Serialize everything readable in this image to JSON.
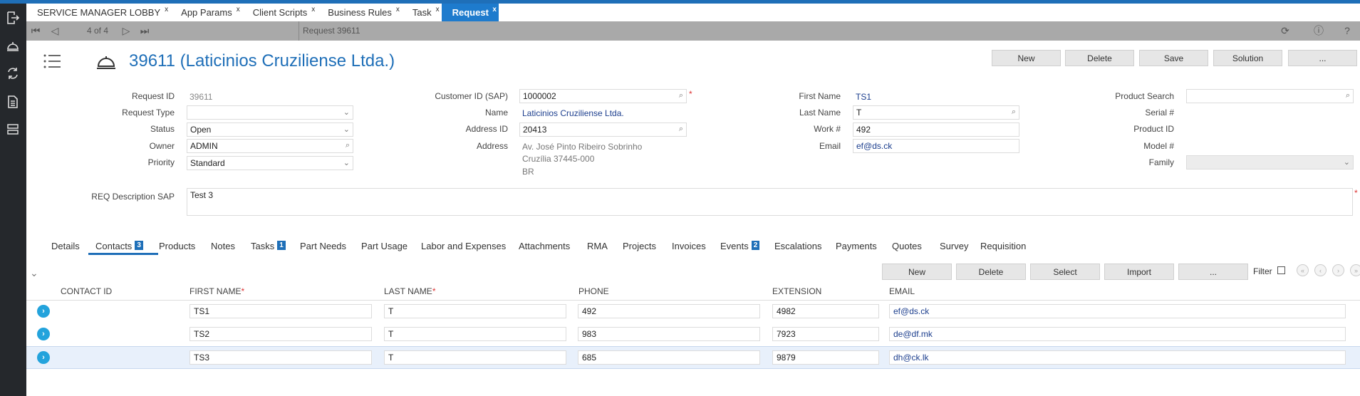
{
  "tabs": [
    {
      "label": "SERVICE MANAGER LOBBY",
      "close": "x"
    },
    {
      "label": "App Params",
      "close": "x"
    },
    {
      "label": "Client Scripts",
      "close": "x"
    },
    {
      "label": "Business Rules",
      "close": "x"
    },
    {
      "label": "Task",
      "close": "x"
    },
    {
      "label": "Request",
      "close": "x",
      "active": true
    }
  ],
  "navbar": {
    "pager": "4 of 4",
    "breadcrumb": "Request 39611"
  },
  "header": {
    "title": "39611 (Laticinios Cruziliense Ltda.)",
    "buttons": {
      "new": "New",
      "delete": "Delete",
      "save": "Save",
      "solution": "Solution",
      "more": "..."
    }
  },
  "form": {
    "request_id": {
      "label": "Request ID",
      "value": "39611"
    },
    "request_type": {
      "label": "Request Type",
      "value": ""
    },
    "status": {
      "label": "Status",
      "value": "Open"
    },
    "owner": {
      "label": "Owner",
      "value": "ADMIN"
    },
    "priority": {
      "label": "Priority",
      "value": "Standard"
    },
    "customer_id": {
      "label": "Customer ID (SAP)",
      "value": "1000002"
    },
    "name": {
      "label": "Name",
      "value": "Laticinios Cruziliense Ltda."
    },
    "address_id": {
      "label": "Address ID",
      "value": "20413"
    },
    "address": {
      "label": "Address",
      "line1": "Av. José Pinto Ribeiro Sobrinho",
      "line2": "Cruzília 37445-000",
      "line3": "BR"
    },
    "first_name": {
      "label": "First Name",
      "value": "TS1"
    },
    "last_name": {
      "label": "Last Name",
      "value": "T"
    },
    "work": {
      "label": "Work #",
      "value": "492"
    },
    "email": {
      "label": "Email",
      "value": "ef@ds.ck"
    },
    "product_search": {
      "label": "Product Search",
      "value": ""
    },
    "serial": {
      "label": "Serial #"
    },
    "product_id": {
      "label": "Product ID"
    },
    "model": {
      "label": "Model #"
    },
    "family": {
      "label": "Family",
      "value": ""
    },
    "req_desc": {
      "label": "REQ Description SAP",
      "value": "Test 3"
    }
  },
  "subtabs": [
    {
      "label": "Details"
    },
    {
      "label": "Contacts",
      "badge": "3",
      "active": true
    },
    {
      "label": "Products"
    },
    {
      "label": "Notes"
    },
    {
      "label": "Tasks",
      "badge": "1"
    },
    {
      "label": "Part Needs"
    },
    {
      "label": "Part Usage"
    },
    {
      "label": "Labor and Expenses"
    },
    {
      "label": "Attachments"
    },
    {
      "label": "RMA"
    },
    {
      "label": "Projects"
    },
    {
      "label": "Invoices"
    },
    {
      "label": "Events",
      "badge": "2"
    },
    {
      "label": "Escalations"
    },
    {
      "label": "Payments"
    },
    {
      "label": "Quotes"
    },
    {
      "label": "Survey"
    },
    {
      "label": "Requisition"
    }
  ],
  "grid": {
    "buttons": {
      "new": "New",
      "delete": "Delete",
      "select": "Select",
      "import": "Import",
      "more": "..."
    },
    "filter_label": "Filter",
    "columns": {
      "contact_id": "CONTACT ID",
      "first_name": "FIRST NAME",
      "last_name": "LAST NAME",
      "phone": "PHONE",
      "extension": "EXTENSION",
      "email": "EMAIL"
    },
    "required_mark": "*",
    "rows": [
      {
        "first": "TS1",
        "last": "T",
        "phone": "492",
        "ext": "4982",
        "email": "ef@ds.ck"
      },
      {
        "first": "TS2",
        "last": "T",
        "phone": "983",
        "ext": "7923",
        "email": "de@df.mk"
      },
      {
        "first": "TS3",
        "last": "T",
        "phone": "685",
        "ext": "9879",
        "email": "dh@ck.lk",
        "selected": true
      }
    ]
  }
}
